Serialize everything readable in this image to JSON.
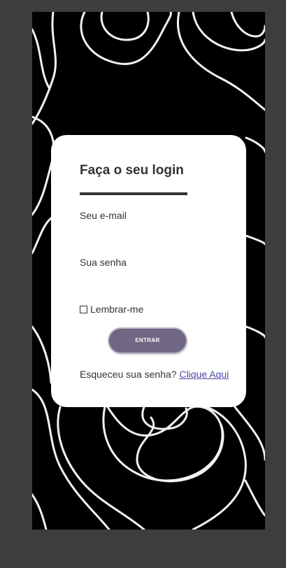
{
  "login": {
    "title": "Faça o seu login",
    "email_label": "Seu e-mail",
    "email_value": "",
    "password_label": "Sua senha",
    "password_value": "",
    "remember_label": "Lembrar-me",
    "remember_checked": false,
    "submit_label": "ENTRAR",
    "forgot_text": "Esqueceu sua senha?",
    "forgot_link": "Clique Aqui"
  },
  "colors": {
    "page_background": "#3d3d3d",
    "pattern_background": "#000000",
    "pattern_lines": "#f2f2f2",
    "card_background": "#ffffff",
    "text": "#333333",
    "button": "#6f6783",
    "link": "#4a4aa8"
  }
}
